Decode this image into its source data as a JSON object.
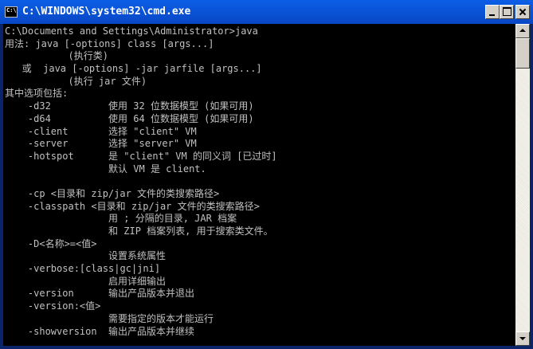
{
  "window": {
    "title": "C:\\WINDOWS\\system32\\cmd.exe",
    "icon": "cmd-icon",
    "icon_glyph": "C:\\"
  },
  "titlebar_buttons": {
    "minimize": "minimize-icon",
    "maximize": "maximize-icon",
    "close": "close-icon"
  },
  "console": {
    "lines": [
      "C:\\Documents and Settings\\Administrator>java",
      "用法: java [-options] class [args...]",
      "           (执行类)",
      "   或  java [-options] -jar jarfile [args...]",
      "           (执行 jar 文件)",
      "其中选项包括:",
      "    -d32          使用 32 位数据模型 (如果可用)",
      "    -d64          使用 64 位数据模型 (如果可用)",
      "    -client       选择 \"client\" VM",
      "    -server       选择 \"server\" VM",
      "    -hotspot      是 \"client\" VM 的同义词 [已过时]",
      "                  默认 VM 是 client.",
      "",
      "    -cp <目录和 zip/jar 文件的类搜索路径>",
      "    -classpath <目录和 zip/jar 文件的类搜索路径>",
      "                  用 ; 分隔的目录, JAR 档案",
      "                  和 ZIP 档案列表, 用于搜索类文件。",
      "    -D<名称>=<值>",
      "                  设置系统属性",
      "    -verbose:[class|gc|jni]",
      "                  启用详细输出",
      "    -version      输出产品版本并退出",
      "    -version:<值>",
      "                  需要指定的版本才能运行",
      "    -showversion  输出产品版本并继续"
    ]
  },
  "colors": {
    "titlebar": "#0a53d6",
    "console_background": "#000000",
    "console_text": "#c0c0c0"
  }
}
